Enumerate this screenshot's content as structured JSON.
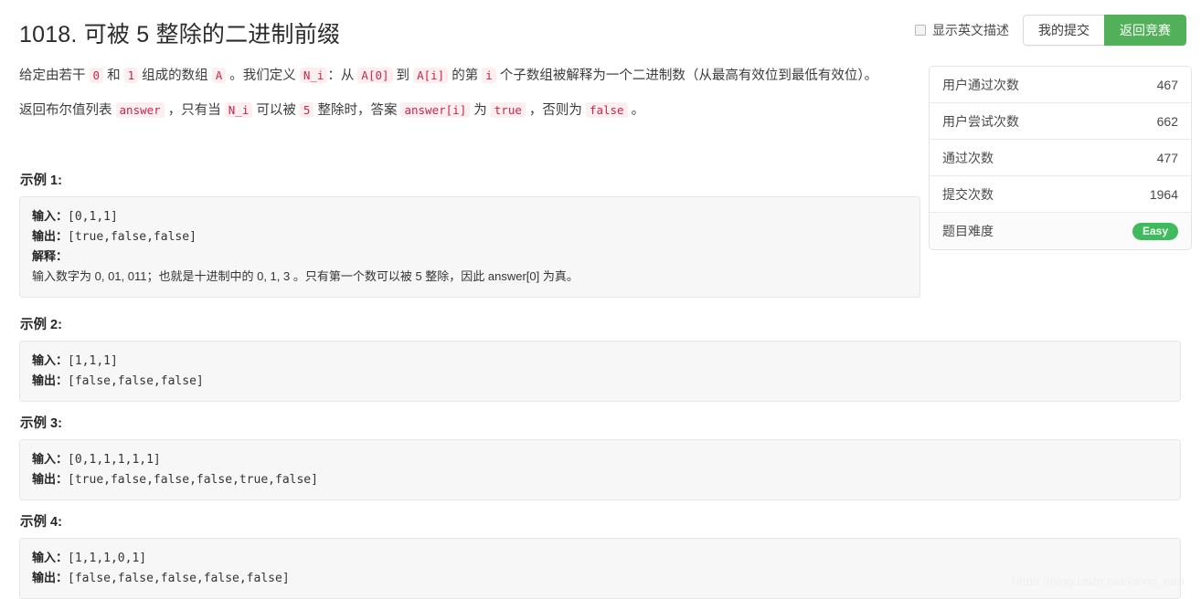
{
  "header": {
    "title": "1018. 可被 5 整除的二进制前缀",
    "english_toggle_label": "显示英文描述",
    "my_submissions_label": "我的提交",
    "back_to_contest_label": "返回竞赛",
    "primary_color": "#53b05a"
  },
  "description": {
    "paragraph1": {
      "t1": "给定由若干 ",
      "c1": "0",
      "t2": " 和 ",
      "c2": "1",
      "t3": " 组成的数组 ",
      "c3": "A",
      "t4": " 。我们定义 ",
      "c4": "N_i",
      "t5": "：从 ",
      "c5": "A[0]",
      "t6": " 到 ",
      "c6": "A[i]",
      "t7": " 的第 ",
      "c7": "i",
      "t8": " 个子数组被解释为一个二进制数（从最高有效位到最低有效位）。"
    },
    "paragraph2": {
      "t1": "返回布尔值列表 ",
      "c1": "answer",
      "t2": " ，只有当 ",
      "c2": "N_i",
      "t3": " 可以被 ",
      "c3": "5",
      "t4": " 整除时，答案 ",
      "c4": "answer[i]",
      "t5": " 为 ",
      "c5": "true",
      "t6": " ，否则为 ",
      "c6": "false",
      "t7": " 。"
    }
  },
  "examples": [
    {
      "heading": "示例 1:",
      "lines": [
        {
          "label": "输入：",
          "value": "[0,1,1]"
        },
        {
          "label": "输出：",
          "value": "[true,false,false]"
        },
        {
          "label": "解释：",
          "value": ""
        },
        {
          "label": "",
          "value": "输入数字为 0, 01, 011；也就是十进制中的 0, 1, 3 。只有第一个数可以被 5 整除，因此 answer[0] 为真。"
        }
      ]
    },
    {
      "heading": "示例 2:",
      "lines": [
        {
          "label": "输入：",
          "value": "[1,1,1]"
        },
        {
          "label": "输出：",
          "value": "[false,false,false]"
        }
      ]
    },
    {
      "heading": "示例 3:",
      "lines": [
        {
          "label": "输入：",
          "value": "[0,1,1,1,1,1]"
        },
        {
          "label": "输出：",
          "value": "[true,false,false,false,true,false]"
        }
      ]
    },
    {
      "heading": "示例 4:",
      "lines": [
        {
          "label": "输入：",
          "value": "[1,1,1,0,1]"
        },
        {
          "label": "输出：",
          "value": "[false,false,false,false,false]"
        }
      ]
    }
  ],
  "stats": {
    "rows": [
      {
        "label": "用户通过次数",
        "value": "467"
      },
      {
        "label": "用户尝试次数",
        "value": "662"
      },
      {
        "label": "通过次数",
        "value": "477"
      },
      {
        "label": "提交次数",
        "value": "1964"
      }
    ],
    "difficulty": {
      "label": "题目难度",
      "value": "Easy",
      "color": "#3ebb5c"
    }
  },
  "watermark": "https://blog.csdn.net/kevin_nan"
}
